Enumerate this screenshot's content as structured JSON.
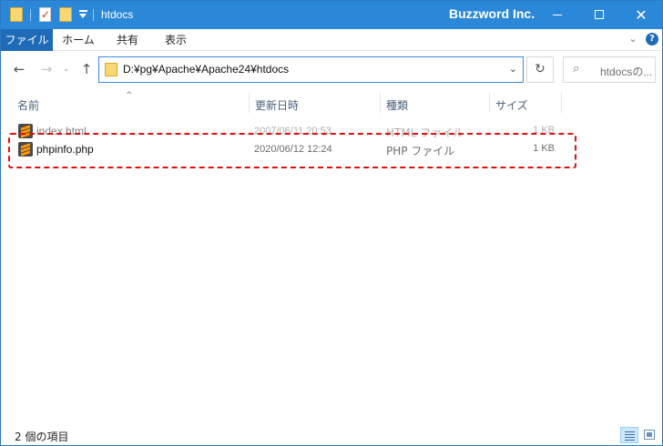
{
  "window": {
    "title": "htdocs",
    "brand": "Buzzword Inc.",
    "controls": {
      "minimize": "minimize",
      "maximize": "maximize",
      "close": "✕"
    }
  },
  "quick_access": {
    "icons": [
      "folder-icon",
      "properties-icon",
      "new-folder-icon",
      "customize-dropdown-icon"
    ]
  },
  "ribbon": {
    "tabs": [
      {
        "label": "ファイル",
        "active": true
      },
      {
        "label": "ホーム"
      },
      {
        "label": "共有"
      },
      {
        "label": "表示"
      }
    ],
    "expand_icon": "chevron-down-icon",
    "help_icon": "?"
  },
  "navigation": {
    "back": "←",
    "forward": "→",
    "recent": "⌄",
    "up": "↑",
    "address": "D:¥pg¥Apache¥Apache24¥htdocs",
    "address_dropdown": "⌄",
    "refresh": "↻",
    "search_placeholder": "htdocsの...",
    "search_icon": "⌕"
  },
  "columns": {
    "name": "名前",
    "modified": "更新日時",
    "type": "種類",
    "size": "サイズ",
    "sort_indicator": "^"
  },
  "files": [
    {
      "name": "index.html",
      "modified": "2007/06/11 20:53",
      "type": "HTML ファイル",
      "size": "1 KB",
      "icon": "sublime-text-icon"
    },
    {
      "name": "phpinfo.php",
      "modified": "2020/06/12 12:24",
      "type": "PHP ファイル",
      "size": "1 KB",
      "icon": "sublime-text-icon"
    }
  ],
  "status": {
    "item_count": "2 個の項目",
    "views": [
      "details-view-icon",
      "large-icons-view-icon"
    ],
    "active_view": "details"
  },
  "colors": {
    "titlebar": "#2b88d8",
    "file_tab": "#1f6bb8",
    "highlight": "#e01010",
    "folder": "#f8d775"
  }
}
